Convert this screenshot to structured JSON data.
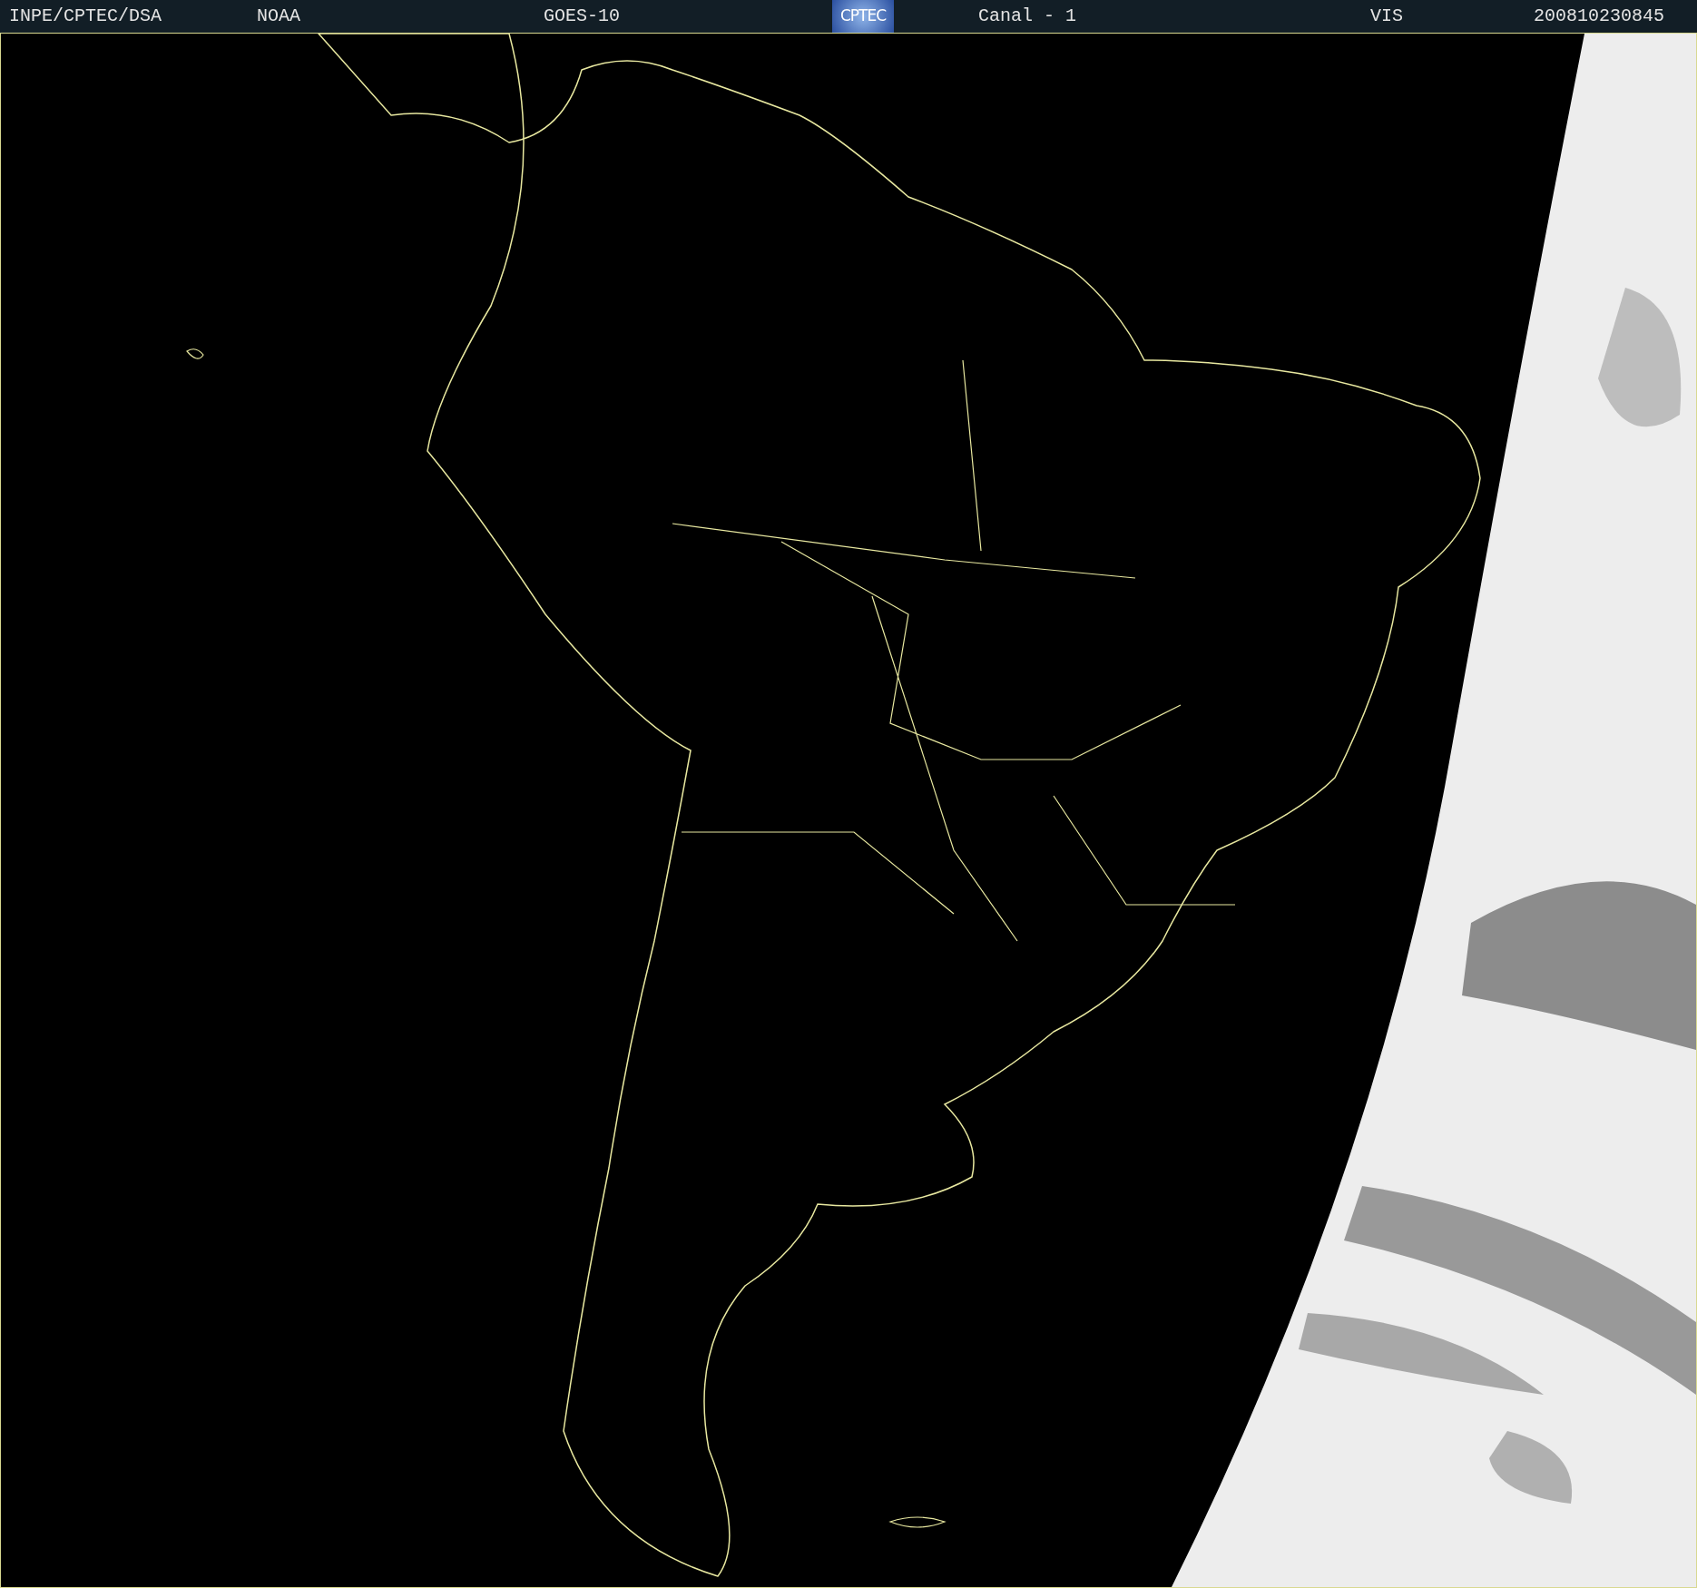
{
  "header": {
    "items": [
      {
        "kind": "text",
        "text": "INPE/CPTEC/DSA"
      },
      {
        "kind": "text",
        "text": "NOAA"
      },
      {
        "kind": "text",
        "text": "GOES-10"
      },
      {
        "kind": "logo",
        "text": "CPTEC"
      },
      {
        "kind": "text",
        "text": "Canal - 1"
      },
      {
        "kind": "text",
        "text": "VIS"
      },
      {
        "kind": "text",
        "text": "200810230845"
      }
    ]
  }
}
